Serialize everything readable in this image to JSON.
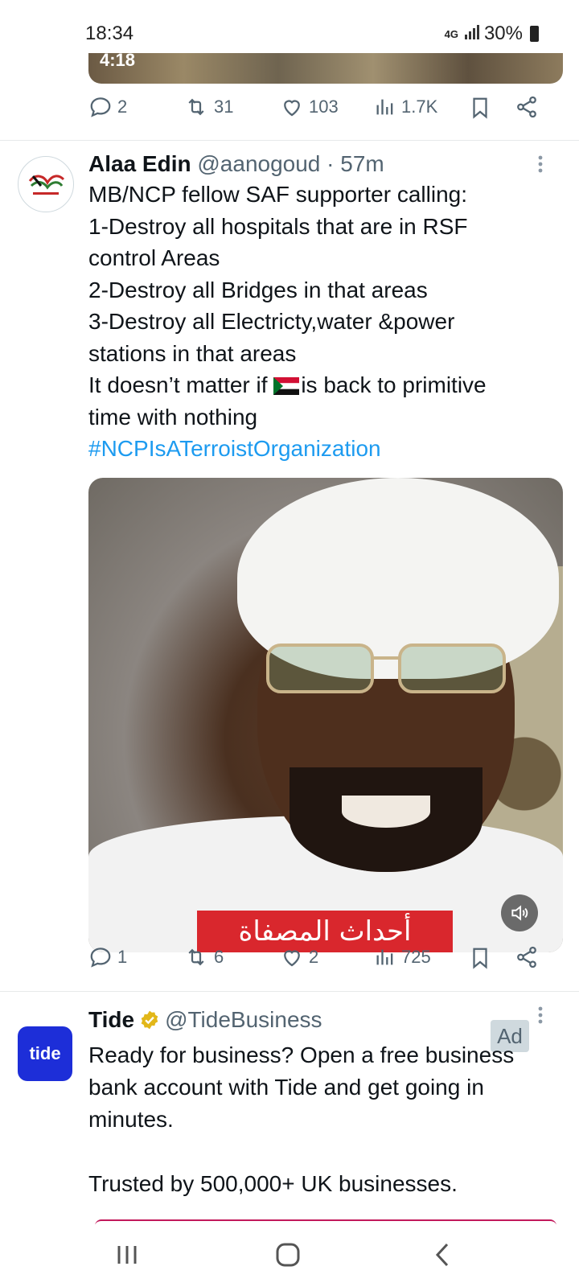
{
  "status_bar": {
    "time": "18:34",
    "network": "4G",
    "battery": "30%"
  },
  "top_tweet": {
    "video_duration": "4:18",
    "actions": {
      "replies": "2",
      "reposts": "31",
      "likes": "103",
      "views": "1.7K"
    }
  },
  "tweet1": {
    "author_name": "Alaa Edin",
    "author_handle": "@aanogoud",
    "time": "· 57m",
    "lines": [
      "MB/NCP fellow SAF supporter calling:",
      "1-Destroy all hospitals that are in RSF",
      "control Areas",
      "2-Destroy all Bridges in that areas",
      "3-Destroy all Electricty,water &power",
      "stations in that areas"
    ],
    "line_flag_prefix": "It doesn’t matter if ",
    "line_flag_suffix": "is back to primitive",
    "line_last": "time with nothing",
    "hashtag": "#NCPIsATerroistOrganization",
    "video_banner_text": "أحداث المصفاة",
    "actions": {
      "replies": "1",
      "reposts": "6",
      "likes": "2",
      "views": "725"
    }
  },
  "tweet2": {
    "avatar_text": "tide",
    "author_name": "Tide",
    "author_handle": "@TideBusiness",
    "ad_label": "Ad",
    "lines": [
      "Ready for business? Open a free business",
      "bank account with Tide and get going in",
      "minutes.",
      "",
      "Trusted by 500,000+ UK businesses."
    ]
  },
  "colors": {
    "accent": "#1d9bf0",
    "secondary_text": "#536471",
    "tide_blue": "#1d2ed8",
    "banner_red": "#d9272d"
  },
  "icons": [
    "reply-icon",
    "repost-icon",
    "like-icon",
    "views-icon",
    "bookmark-icon",
    "share-icon",
    "more-icon",
    "verified-icon",
    "sound-icon",
    "recents-icon",
    "home-icon",
    "back-icon"
  ]
}
